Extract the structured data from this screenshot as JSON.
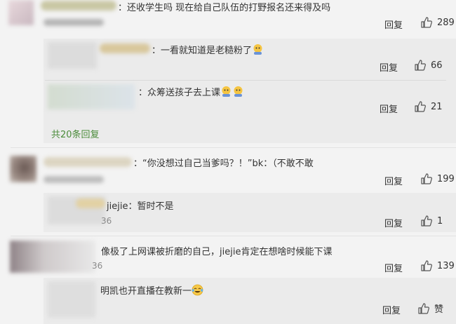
{
  "comments": [
    {
      "text": "：还收学生吗  现在给自己队伍的打野报名还来得及吗",
      "reply_label": "回复",
      "likes": "289",
      "replies": [
        {
          "text": "：一看就知道是老糙粉了",
          "reply_label": "回复",
          "likes": "66"
        },
        {
          "text": "：众筹送孩子去上课",
          "reply_label": "回复",
          "likes": "21"
        }
      ],
      "more_replies": "共20条回复"
    },
    {
      "text": "：“你没想过自己当爹吗？！”bk：（不敢不敢",
      "reply_label": "回复",
      "likes": "199",
      "replies": [
        {
          "text": "jiejie：暂时不是",
          "time_suffix": "36",
          "reply_label": "回复",
          "likes": "1"
        }
      ]
    },
    {
      "text": "像极了上网课被折磨的自己，jiejie肯定在想啥时候能下课",
      "time_suffix": "36",
      "reply_label": "回复",
      "likes": "139",
      "replies": [
        {
          "text": "明凯也开直播在教新一",
          "reply_label": "回复",
          "likes": "赞"
        }
      ]
    }
  ],
  "icons": [
    "thumbs-up-icon",
    "crying-emoji-icon",
    "tears-of-joy-icon"
  ],
  "colors": {
    "link_green": "#4a8b3a",
    "reply_bg": "#ebebeb",
    "text": "#333333"
  }
}
